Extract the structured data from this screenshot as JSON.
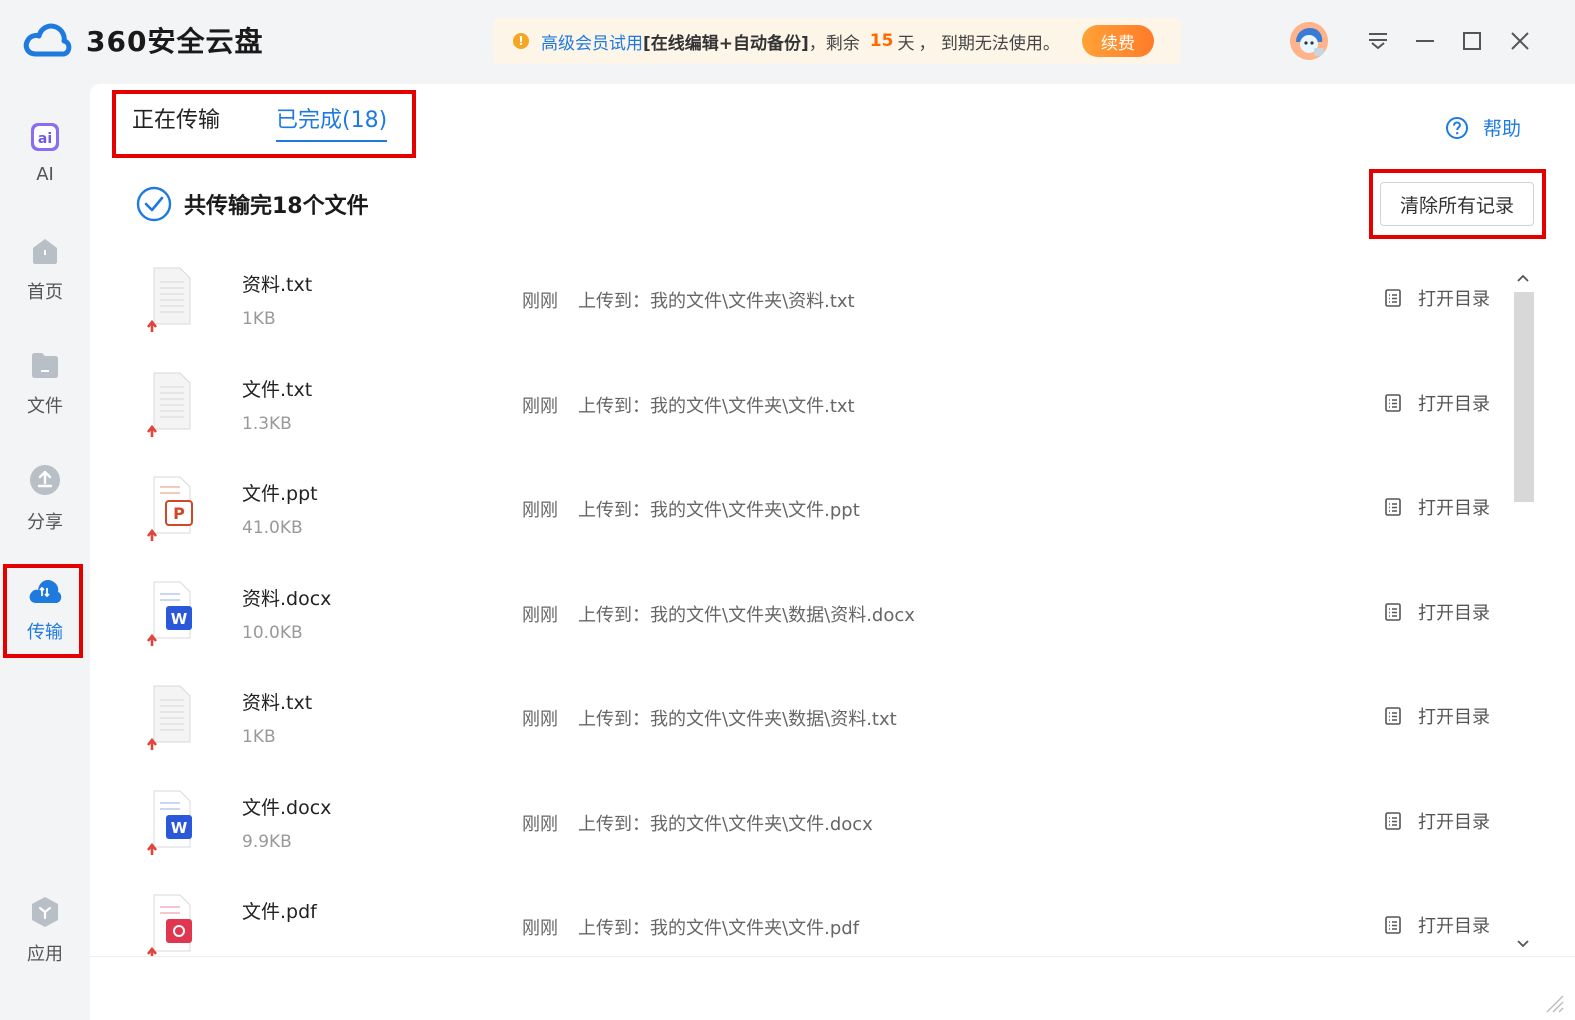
{
  "app": {
    "title": "360安全云盘"
  },
  "promo": {
    "text_prefix": "高级会员试用",
    "text_bold": "[在线编辑+自动备份]",
    "text_remaining": "，剩余",
    "days": "15",
    "days_unit": "天",
    "text_suffix": "， 到期无法使用。",
    "renew_label": "续费",
    "accent_color": "#ff7b2a"
  },
  "window_controls": [
    "menu-icon",
    "minimize-icon",
    "maximize-icon",
    "close-icon"
  ],
  "sidebar": {
    "items": [
      {
        "label": "AI",
        "icon": "ai-icon"
      },
      {
        "label": "首页",
        "icon": "home-icon"
      },
      {
        "label": "文件",
        "icon": "folder-icon"
      },
      {
        "label": "分享",
        "icon": "share-icon"
      },
      {
        "label": "传输",
        "icon": "transfer-cloud-icon",
        "active": true
      },
      {
        "label": "应用",
        "icon": "apps-icon"
      }
    ]
  },
  "tabs": [
    {
      "label": "正在传输",
      "active": false
    },
    {
      "label": "已完成(18)",
      "active": true
    }
  ],
  "help_label": "帮助",
  "summary": "共传输完18个文件",
  "clear_button": "清除所有记录",
  "open_dir_label": "打开目录",
  "files": [
    {
      "name": "资料.txt",
      "size": "1KB",
      "time": "刚刚",
      "dest": "上传到：我的文件\\文件夹\\资料.txt",
      "type": "txt"
    },
    {
      "name": "文件.txt",
      "size": "1.3KB",
      "time": "刚刚",
      "dest": "上传到：我的文件\\文件夹\\文件.txt",
      "type": "txt"
    },
    {
      "name": "文件.ppt",
      "size": "41.0KB",
      "time": "刚刚",
      "dest": "上传到：我的文件\\文件夹\\文件.ppt",
      "type": "ppt"
    },
    {
      "name": "资料.docx",
      "size": "10.0KB",
      "time": "刚刚",
      "dest": "上传到：我的文件\\文件夹\\数据\\资料.docx",
      "type": "docx"
    },
    {
      "name": "资料.txt",
      "size": "1KB",
      "time": "刚刚",
      "dest": "上传到：我的文件\\文件夹\\数据\\资料.txt",
      "type": "txt"
    },
    {
      "name": "文件.docx",
      "size": "9.9KB",
      "time": "刚刚",
      "dest": "上传到：我的文件\\文件夹\\文件.docx",
      "type": "docx"
    },
    {
      "name": "文件.pdf",
      "size": "",
      "time": "刚刚",
      "dest": "上传到：我的文件\\文件夹\\文件.pdf",
      "type": "pdf"
    }
  ],
  "colors": {
    "accent": "#1f7ae0",
    "highlight_box": "#e50000"
  }
}
